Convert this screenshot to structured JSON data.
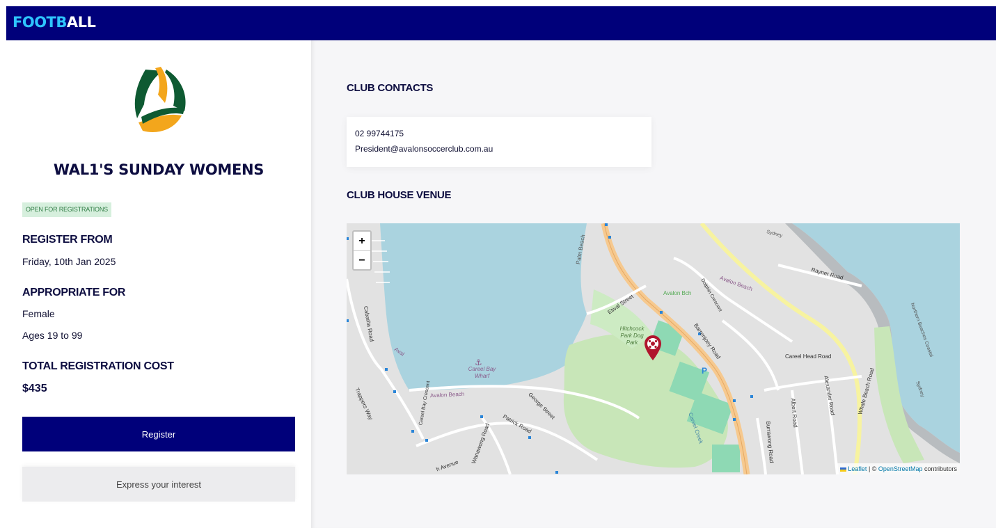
{
  "brand": {
    "part1": "FOOTB",
    "part2": "ALL"
  },
  "team": {
    "name": "WAL1'S SUNDAY WOMENS",
    "status": "OPEN FOR REGISTRATIONS",
    "register_from_label": "REGISTER FROM",
    "register_from_value": "Friday, 10th Jan 2025",
    "appropriate_label": "APPROPRIATE FOR",
    "gender": "Female",
    "ages": "Ages 19 to 99",
    "cost_label": "TOTAL REGISTRATION COST",
    "cost_value": "$435"
  },
  "actions": {
    "register": "Register",
    "express": "Express your interest"
  },
  "contacts": {
    "heading": "CLUB CONTACTS",
    "phone": "02 99744175",
    "email": "President@avalonsoccerclub.com.au"
  },
  "venue": {
    "heading": "CLUB HOUSE VENUE",
    "zoom_in": "+",
    "zoom_out": "−",
    "attribution": {
      "leaflet": "Leaflet",
      "sep": " | © ",
      "osm": "OpenStreetMap",
      "tail": " contributors"
    },
    "labels": {
      "palm_beach": "Palm Beach",
      "etival": "Etival Street",
      "avalon_bch": "Avalon Bch",
      "avalon_beach": "Avalon Beach",
      "dolphin": "Dolphin Crescent",
      "rayner": "Rayner Road",
      "sydney": "Sydney",
      "hitchcock": "Hitchcock Park Dog Park",
      "barrenjoey": "Barrenjoey Road",
      "careel_head": "Careel Head Road",
      "careel_wharf": "Careel Bay Wharf",
      "avalon_beach2": "Avalon Beach",
      "george": "George Street",
      "patrick": "Patrick Road",
      "wanawong": "Wanawong Road",
      "cabarita": "Cabarita Road",
      "trappers": "Trappers Way",
      "careel_bay_cres": "Careel Bay Crescent",
      "albert": "Albert Road",
      "alexander": "Alexander Road",
      "whale_beach": "Whale Beach Road",
      "burrawong": "Burrawong Road",
      "careel_creek": "Careel Creek",
      "northern_beaches": "Northern Beaches Coastal",
      "parking": "P",
      "avalon_short": "Aval",
      "avenue": "h Avenue",
      "sydney2": "Sydney"
    }
  }
}
